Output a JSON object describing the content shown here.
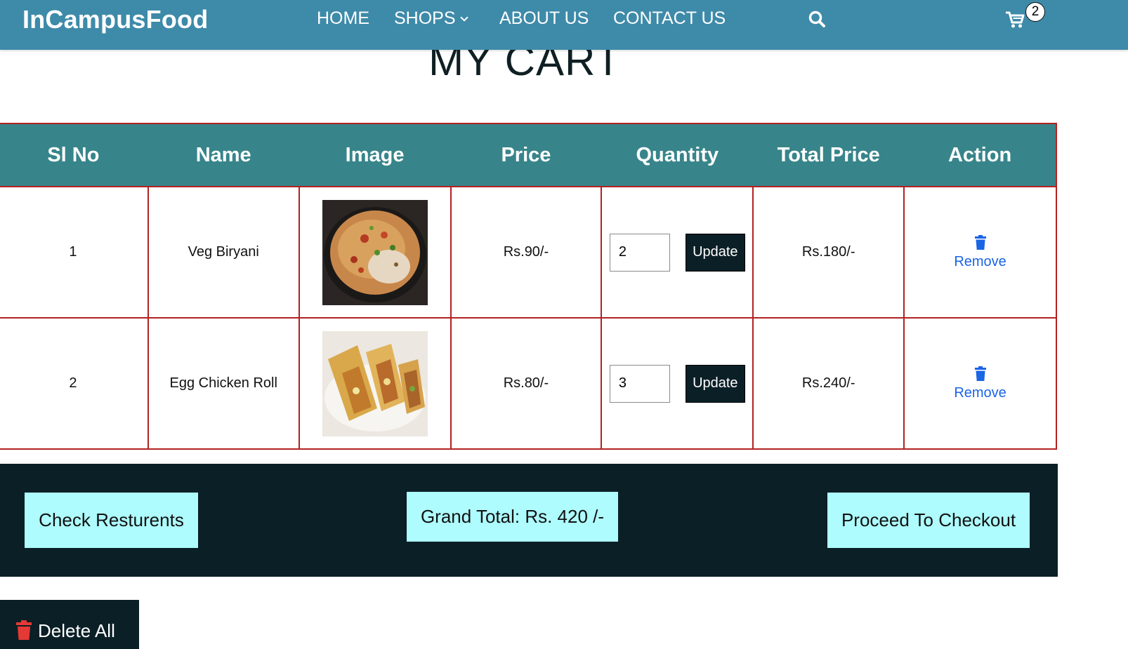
{
  "navbar": {
    "brand": "InCampusFood",
    "links": [
      "HOME",
      "SHOPS",
      "ABOUT US",
      "CONTACT US"
    ],
    "cart_count": "2",
    "icons": [
      "search-icon",
      "cart-icon",
      "chevron-down-icon"
    ]
  },
  "page": {
    "title": "MY CART"
  },
  "table": {
    "headers": [
      "Sl No",
      "Name",
      "Image",
      "Price",
      "Quantity",
      "Total Price",
      "Action"
    ],
    "rows": [
      {
        "sl": "1",
        "name": "Veg Biryani",
        "image": "veg-biryani-image",
        "price": "Rs.90/-",
        "quantity": "2",
        "update_label": "Update",
        "total": "Rs.180/-",
        "action": "Remove"
      },
      {
        "sl": "2",
        "name": "Egg Chicken Roll",
        "image": "egg-chicken-roll-image",
        "price": "Rs.80/-",
        "quantity": "3",
        "update_label": "Update",
        "total": "Rs.240/-",
        "action": "Remove"
      }
    ]
  },
  "footer": {
    "check_label": "Check Resturents",
    "grand_total": "Grand Total: Rs. 420 /-",
    "checkout_label": "Proceed To Checkout",
    "delete_all_label": "Delete All"
  },
  "colors": {
    "navbar_bg": "#3e8aa9",
    "table_header_bg": "#37858a",
    "table_border": "#b22222",
    "dark_bg": "#0b1f26",
    "light_button_bg": "#aefcfd",
    "remove_link": "#1a64e6",
    "delete_icon": "#e53935"
  }
}
